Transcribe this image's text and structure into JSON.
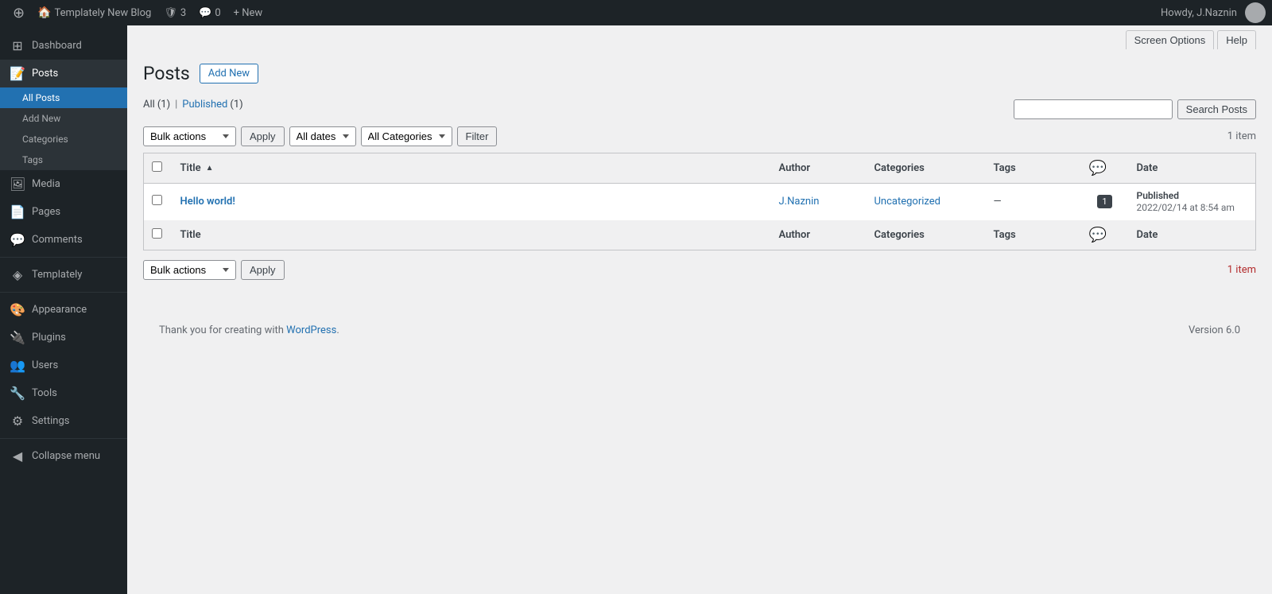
{
  "adminbar": {
    "site_icon": "⊕",
    "site_name": "Templately New Blog",
    "updates_icon": "🛡",
    "updates_count": "3",
    "comments_icon": "💬",
    "comments_count": "0",
    "new_label": "+ New",
    "howdy": "Howdy, J.Naznin",
    "user_icon": "👤"
  },
  "sidebar": {
    "items": [
      {
        "id": "dashboard",
        "label": "Dashboard",
        "icon": "⊞"
      },
      {
        "id": "posts",
        "label": "Posts",
        "icon": "📝",
        "active": true
      },
      {
        "id": "all-posts",
        "label": "All Posts",
        "sub": true,
        "active": true
      },
      {
        "id": "add-new",
        "label": "Add New",
        "sub": true
      },
      {
        "id": "categories",
        "label": "Categories",
        "sub": true
      },
      {
        "id": "tags",
        "label": "Tags",
        "sub": true
      },
      {
        "id": "media",
        "label": "Media",
        "icon": "🖼"
      },
      {
        "id": "pages",
        "label": "Pages",
        "icon": "📄"
      },
      {
        "id": "comments",
        "label": "Comments",
        "icon": "💬"
      },
      {
        "id": "templately",
        "label": "Templately",
        "icon": "◈"
      },
      {
        "id": "appearance",
        "label": "Appearance",
        "icon": "🎨"
      },
      {
        "id": "plugins",
        "label": "Plugins",
        "icon": "🔌"
      },
      {
        "id": "users",
        "label": "Users",
        "icon": "👥"
      },
      {
        "id": "tools",
        "label": "Tools",
        "icon": "🔧"
      },
      {
        "id": "settings",
        "label": "Settings",
        "icon": "⚙"
      },
      {
        "id": "collapse",
        "label": "Collapse menu",
        "icon": "◀"
      }
    ]
  },
  "topbar": {
    "screen_options": "Screen Options",
    "help": "Help"
  },
  "page": {
    "title": "Posts",
    "add_new": "Add New",
    "search_input_placeholder": "",
    "search_button": "Search Posts",
    "filters": {
      "bulk_actions": "Bulk actions",
      "all_dates": "All dates",
      "all_categories": "All Categories",
      "filter": "Filter",
      "apply": "Apply"
    },
    "subnav": {
      "all": "All",
      "all_count": "(1)",
      "published": "Published",
      "published_count": "(1)"
    },
    "item_count_top": "1 item",
    "item_count_bottom": "1 item"
  },
  "table": {
    "headers": {
      "title": "Title",
      "author": "Author",
      "categories": "Categories",
      "tags": "Tags",
      "comments": "💬",
      "date": "Date"
    },
    "rows": [
      {
        "title": "Hello world!",
        "author": "J.Naznin",
        "categories": "Uncategorized",
        "tags": "—",
        "comments": "1",
        "status": "Published",
        "date": "2022/02/14 at 8:54 am"
      }
    ]
  },
  "footer": {
    "thank_you": "Thank you for creating with",
    "wp_link_text": "WordPress",
    "version": "Version 6.0"
  }
}
